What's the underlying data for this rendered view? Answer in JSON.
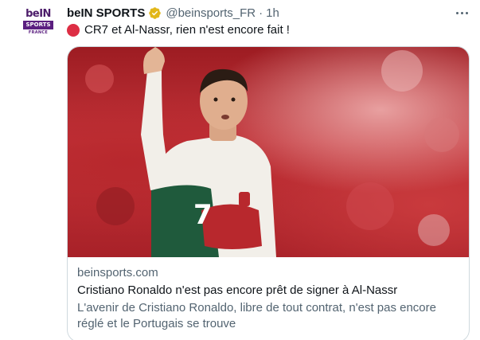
{
  "account": {
    "display_name": "beIN SPORTS",
    "handle": "@beinsports_FR",
    "separator": "·",
    "time": "1h",
    "avatar_logo_text": "beIN",
    "avatar_logo_bar": "SPORTS",
    "avatar_logo_sub": "FRANCE"
  },
  "tweet": {
    "emoji_icon": "red-circle-icon",
    "text": "CR7 et Al-Nassr, rien n'est encore fait !"
  },
  "card": {
    "domain": "beinsports.com",
    "title": "Cristiano Ronaldo n'est pas encore prêt de signer à Al-Nassr",
    "description_line1": "L'avenir de Cristiano Ronaldo, libre de tout contrat, n'est pas encore",
    "description_line2": "réglé et le Portugais se trouve"
  },
  "colors": {
    "text_primary": "#0f1419",
    "text_secondary": "#536471",
    "verified_gold": "#e2b719",
    "card_border": "#cfd9de",
    "emoji_red": "#dd2e44"
  }
}
